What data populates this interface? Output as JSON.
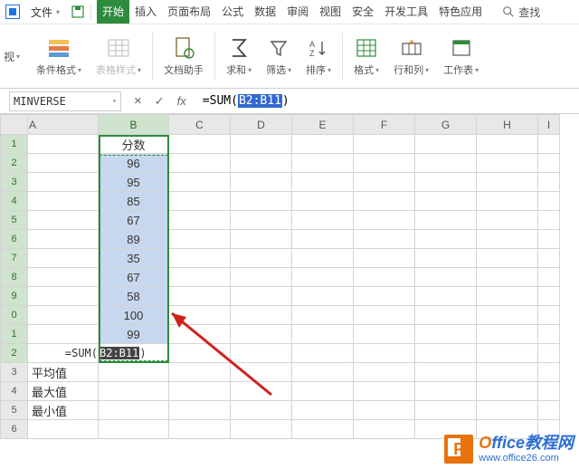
{
  "top": {
    "file_label": "文件",
    "tabs": [
      "开始",
      "插入",
      "页面布局",
      "公式",
      "数据",
      "审阅",
      "视图",
      "安全",
      "开发工具",
      "特色应用"
    ],
    "active_tab": 0,
    "find_label": "查找"
  },
  "ribbon": {
    "view_label": "视",
    "cond_fmt": "条件格式",
    "table_style": "表格样式",
    "doc_helper": "文档助手",
    "sum": "求和",
    "filter": "筛选",
    "sort": "排序",
    "format": "格式",
    "rowcol": "行和列",
    "sheet": "工作表"
  },
  "formula_bar": {
    "name_box": "MINVERSE",
    "cancel": "×",
    "confirm": "✓",
    "fx": "fx",
    "prefix": "=SUM(",
    "selection": "B2:B11",
    "suffix": ")"
  },
  "grid": {
    "col_headers": [
      "A",
      "B",
      "C",
      "D",
      "E",
      "F",
      "G",
      "H",
      "I"
    ],
    "row_headers": [
      "1",
      "2",
      "3",
      "4",
      "5",
      "6",
      "7",
      "8",
      "9",
      "0",
      "1",
      "2",
      "3",
      "4",
      "5",
      "6"
    ],
    "header_b1": "分数",
    "b_values": [
      "96",
      "95",
      "85",
      "67",
      "89",
      "35",
      "67",
      "58",
      "100",
      "99"
    ],
    "b12_prefix": "=SUM(",
    "b12_sel": "B2:B11",
    "b12_suffix": ")",
    "a13": "平均值",
    "a14": "最大值",
    "a15": "最小值"
  },
  "watermark": {
    "badge_letter": "P",
    "brand_o": "O",
    "brand_rest": "ffice教程网",
    "url": "www.office26.com"
  },
  "chart_data": {
    "type": "table",
    "title": "分数",
    "categories": [
      "B2",
      "B3",
      "B4",
      "B5",
      "B6",
      "B7",
      "B8",
      "B9",
      "B10",
      "B11"
    ],
    "values": [
      96,
      95,
      85,
      67,
      89,
      35,
      67,
      58,
      100,
      99
    ],
    "formula": "=SUM(B2:B11)"
  }
}
